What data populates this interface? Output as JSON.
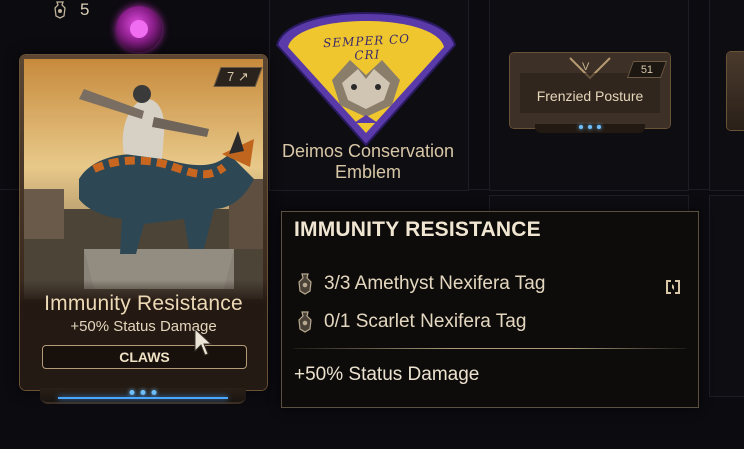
{
  "counter": {
    "value": "5",
    "icon": "nexifera-tag-icon"
  },
  "focused_mod": {
    "name": "Immunity Resistance",
    "description": "+50% Status Damage",
    "type": "CLAWS",
    "rank": "7",
    "polarity_icon": "madurai-polarity-icon"
  },
  "emblem": {
    "label": "Deimos Conservation Emblem",
    "patch_text": "SEMPER CO CRI"
  },
  "small_mod": {
    "name": "Frenzied Posture",
    "rank": "51",
    "polarity": "V"
  },
  "tooltip": {
    "title": "IMMUNITY RESISTANCE",
    "tags": [
      {
        "text": "3/3 Amethyst Nexifera Tag",
        "icon": "amethyst-tag-icon"
      },
      {
        "text": "0/1 Scarlet Nexifera Tag",
        "icon": "scarlet-tag-icon"
      }
    ],
    "stat": "+50% Status Damage"
  },
  "colors": {
    "accent_gold": "#d8c7a6",
    "orb_purple": "#d63bd6",
    "glow_blue": "#6fc0ff",
    "emblem_yellow": "#f0c62e",
    "emblem_purple": "#5a3aa8"
  }
}
